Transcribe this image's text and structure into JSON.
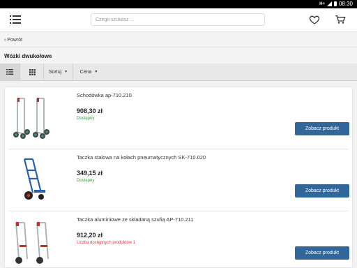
{
  "status_bar": {
    "network": "H+",
    "clock": "08:30"
  },
  "header": {
    "search_placeholder": "Czego szukasz ..."
  },
  "back_label": "Powrót",
  "category_title": "Wózki dwukołowe",
  "toolbar": {
    "sort_label": "Sortuj",
    "price_label": "Cena"
  },
  "products": [
    {
      "name": "Schodówka ap-710.210",
      "price": "908,30 zł",
      "status": "Dostępny",
      "status_color": "#2e9e3e",
      "button": "Zobacz produkt",
      "image": "two-stair-climbing-hand-trucks"
    },
    {
      "name": "Taczka stalowa na kołach pneumatycznych SK-710.020",
      "price": "349,15 zł",
      "status": "Dostępny",
      "status_color": "#2e9e3e",
      "button": "Zobacz produkt",
      "image": "blue-steel-hand-truck"
    },
    {
      "name": "Taczka aluminiowe ze składaną szufią AP-710.211",
      "price": "912,20 zł",
      "status": "Liczba dostępnych produktów 1",
      "status_color": "#d63b2f",
      "button": "Zobacz produkt",
      "image": "two-aluminium-hand-trucks"
    }
  ],
  "colors": {
    "accent": "#336699",
    "available": "#2e9e3e",
    "limited": "#d63b2f"
  }
}
